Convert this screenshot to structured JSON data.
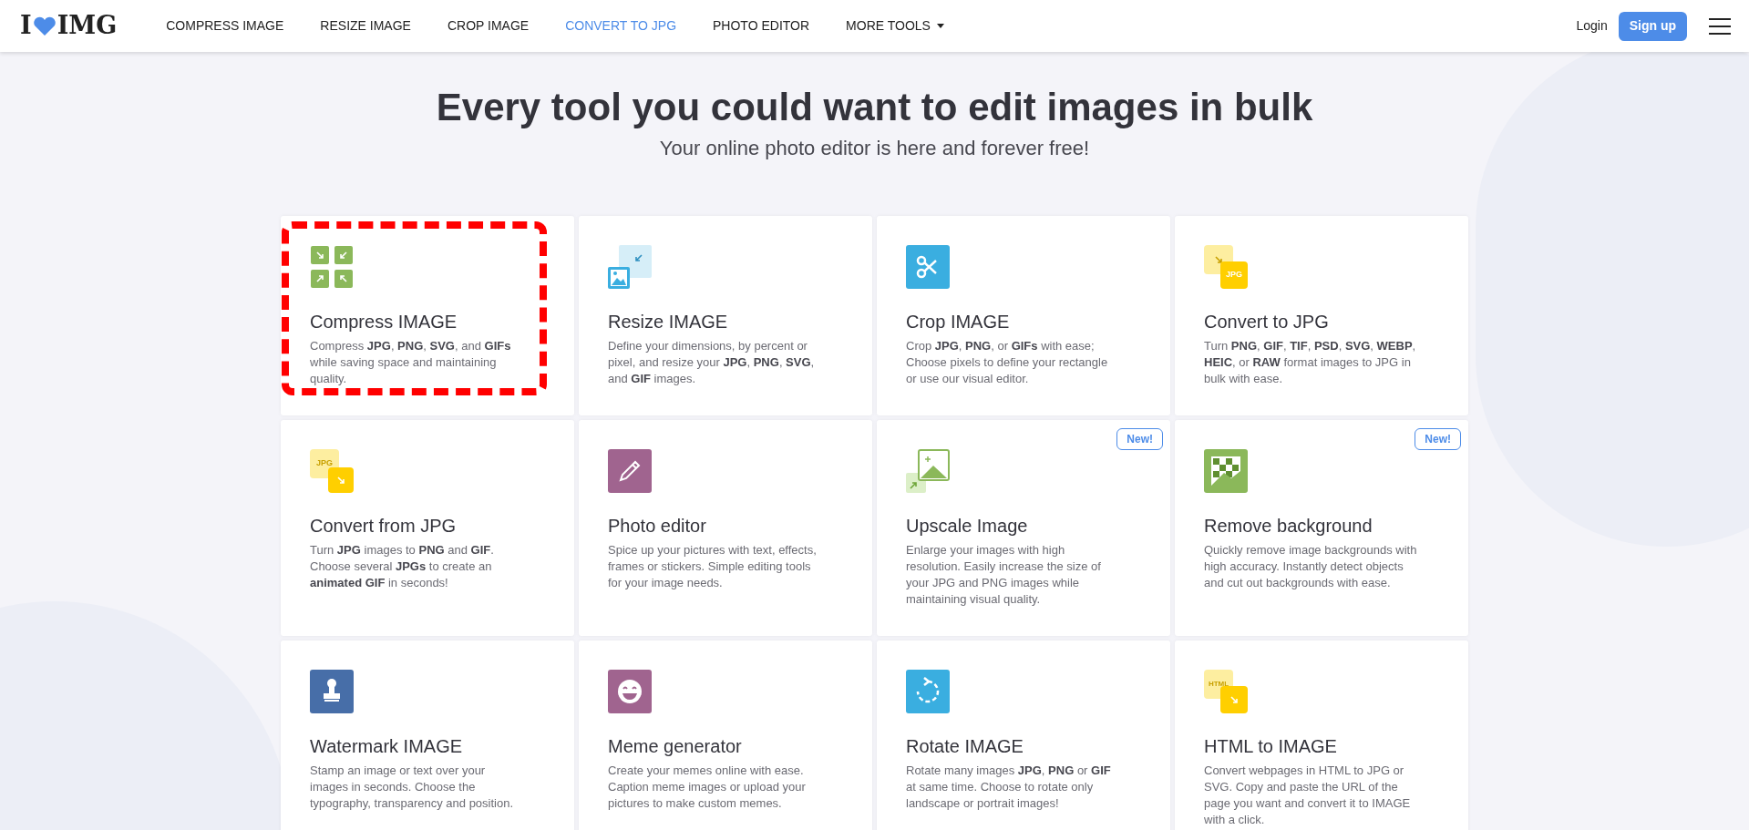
{
  "header": {
    "logo": {
      "left": "I",
      "right": "IMG"
    },
    "nav": [
      {
        "label": "COMPRESS IMAGE",
        "selected": false,
        "dropdown": false
      },
      {
        "label": "RESIZE IMAGE",
        "selected": false,
        "dropdown": false
      },
      {
        "label": "CROP IMAGE",
        "selected": false,
        "dropdown": false
      },
      {
        "label": "CONVERT TO JPG",
        "selected": true,
        "dropdown": false
      },
      {
        "label": "PHOTO EDITOR",
        "selected": false,
        "dropdown": false
      },
      {
        "label": "MORE TOOLS",
        "selected": false,
        "dropdown": true
      }
    ],
    "login": "Login",
    "signup": "Sign up"
  },
  "hero": {
    "title": "Every tool you could want to edit images in bulk",
    "subtitle": "Your online photo editor is here and forever free!"
  },
  "tools": [
    {
      "kind": "compress",
      "title": "Compress IMAGE",
      "description": "Compress **JPG**, **PNG**, **SVG**, and **GIFs** while saving space and maintaining quality.",
      "highlighted": true
    },
    {
      "kind": "resize",
      "title": "Resize IMAGE",
      "description": "Define your dimensions, by percent or pixel, and resize your **JPG**, **PNG**, **SVG**, and **GIF** images.",
      "highlighted": false
    },
    {
      "kind": "crop",
      "title": "Crop IMAGE",
      "description": "Crop **JPG**, **PNG**, or **GIFs** with ease; Choose pixels to define your rectangle or use our visual editor.",
      "highlighted": false
    },
    {
      "kind": "to-jpg",
      "title": "Convert to JPG",
      "icon_text": "JPG",
      "description": "Turn **PNG**, **GIF**, **TIF**, **PSD**, **SVG**, **WEBP**, **HEIC**, or **RAW** format images to JPG in bulk with ease.",
      "highlighted": false
    },
    {
      "kind": "from-jpg",
      "title": "Convert from JPG",
      "icon_text": "JPG",
      "description": "Turn **JPG** images to **PNG** and **GIF**. Choose several **JPGs** to create an **animated GIF** in seconds!",
      "highlighted": false
    },
    {
      "kind": "editor",
      "title": "Photo editor",
      "description": "Spice up your pictures with text, effects, frames or stickers. Simple editing tools for your image needs.",
      "highlighted": false
    },
    {
      "kind": "upscale",
      "title": "Upscale Image",
      "badge": "New!",
      "description": "Enlarge your images with high resolution. Easily increase the size of your JPG and PNG images while maintaining visual quality.",
      "highlighted": false
    },
    {
      "kind": "remove-bg",
      "title": "Remove background",
      "badge": "New!",
      "description": "Quickly remove image backgrounds with high accuracy. Instantly detect objects and cut out backgrounds with ease.",
      "highlighted": false
    },
    {
      "kind": "watermark",
      "title": "Watermark IMAGE",
      "description": "Stamp an image or text over your images in seconds. Choose the typography, transparency and position.",
      "highlighted": false
    },
    {
      "kind": "meme",
      "title": "Meme generator",
      "description": "Create your memes online with ease. Caption meme images or upload your pictures to make custom memes.",
      "highlighted": false
    },
    {
      "kind": "rotate",
      "title": "Rotate IMAGE",
      "description": "Rotate many images **JPG**, **PNG** or **GIF** at same time. Choose to rotate only landscape or portrait images!",
      "highlighted": false
    },
    {
      "kind": "html",
      "title": "HTML to IMAGE",
      "icon_text": "HTML",
      "description": "Convert webpages in HTML to JPG or SVG. Copy and paste the URL of the page you want and convert it to IMAGE with a click.",
      "highlighted": false
    }
  ]
}
